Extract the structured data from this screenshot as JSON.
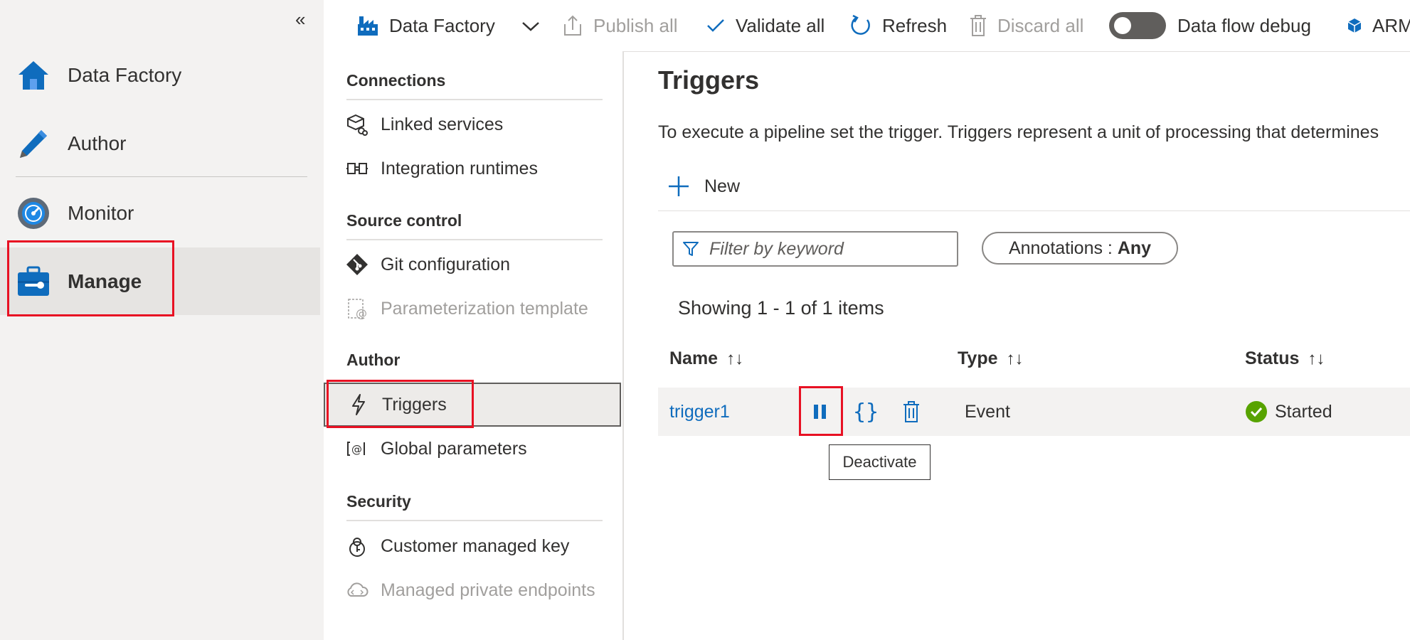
{
  "left_nav": {
    "collapse_icon": "double-chevron-left",
    "items": [
      {
        "label": "Data Factory",
        "icon": "home-icon"
      },
      {
        "label": "Author",
        "icon": "pencil-icon"
      },
      {
        "label": "Monitor",
        "icon": "gauge-icon"
      },
      {
        "label": "Manage",
        "icon": "toolbox-icon"
      }
    ]
  },
  "toolbar": {
    "factory": "Data Factory",
    "publish_all": "Publish all",
    "validate_all": "Validate all",
    "refresh": "Refresh",
    "discard_all": "Discard all",
    "data_flow_debug": "Data flow debug",
    "arm": "ARM"
  },
  "manage_menu": {
    "sections": [
      {
        "heading": "Connections",
        "items": [
          {
            "label": "Linked services",
            "icon": "linked-services-icon",
            "disabled": false
          },
          {
            "label": "Integration runtimes",
            "icon": "integration-runtime-icon",
            "disabled": false
          }
        ]
      },
      {
        "heading": "Source control",
        "items": [
          {
            "label": "Git configuration",
            "icon": "git-icon",
            "disabled": false
          },
          {
            "label": "Parameterization template",
            "icon": "parameterization-icon",
            "disabled": true
          }
        ]
      },
      {
        "heading": "Author",
        "items": [
          {
            "label": "Triggers",
            "icon": "lightning-icon",
            "selected": true
          },
          {
            "label": "Global parameters",
            "icon": "global-parameters-icon",
            "disabled": false
          }
        ]
      },
      {
        "heading": "Security",
        "items": [
          {
            "label": "Customer managed key",
            "icon": "key-icon",
            "disabled": false
          },
          {
            "label": "Managed private endpoints",
            "icon": "cloud-endpoint-icon",
            "disabled": true
          }
        ]
      }
    ]
  },
  "main": {
    "title": "Triggers",
    "description": "To execute a pipeline set the trigger. Triggers represent a unit of processing that determines",
    "new_label": "New",
    "filter_placeholder": "Filter by keyword",
    "annotations_label": "Annotations : ",
    "annotations_value": "Any",
    "showing": "Showing 1 - 1 of 1 items",
    "columns": [
      "Name",
      "Type",
      "Status"
    ],
    "rows": [
      {
        "name": "trigger1",
        "type": "Event",
        "status": "Started"
      }
    ],
    "tooltip": "Deactivate"
  },
  "colors": {
    "accent": "#0f6cbd",
    "highlight": "#e81123",
    "success": "#57a300",
    "nav_bg": "#f3f2f1"
  }
}
